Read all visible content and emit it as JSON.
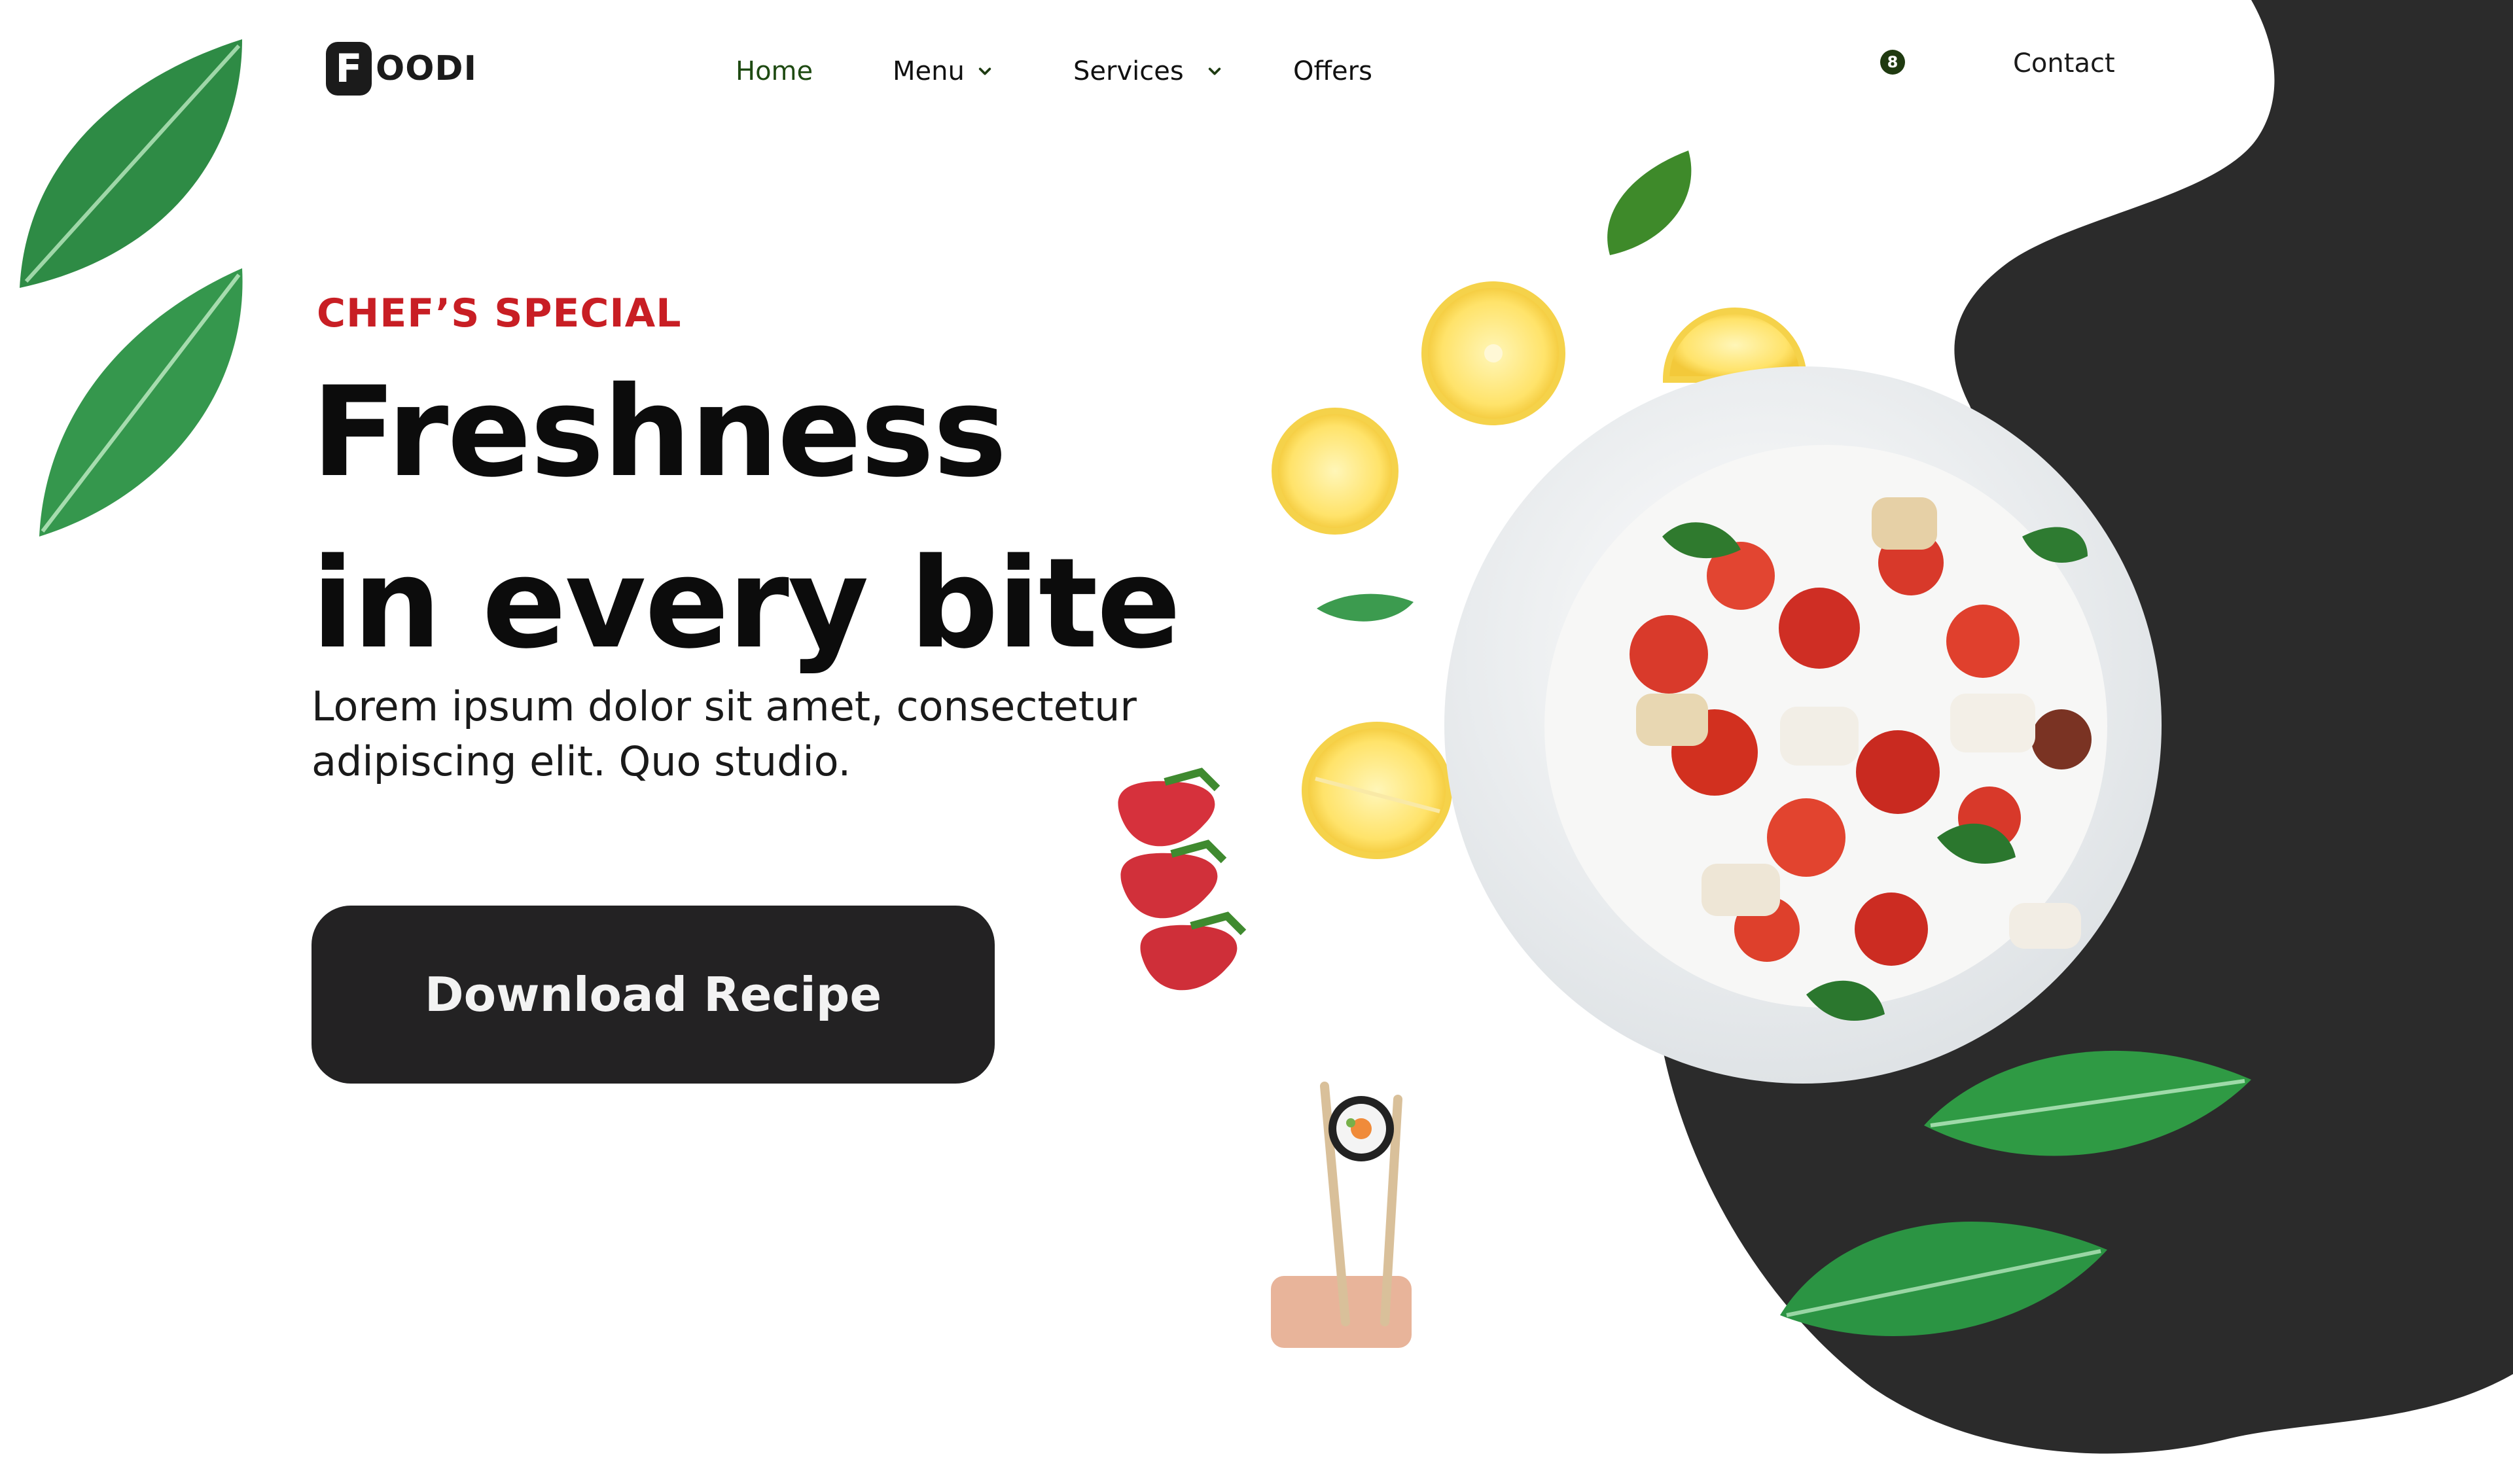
{
  "header": {
    "logo_letter": "F",
    "logo_text": "OODI",
    "nav": [
      {
        "label": "Home",
        "active": true,
        "dropdown": false
      },
      {
        "label": "Menu",
        "active": false,
        "dropdown": true
      },
      {
        "label": "Services",
        "active": false,
        "dropdown": true
      },
      {
        "label": "Offers",
        "active": false,
        "dropdown": false
      }
    ],
    "cart_badge_count": "8",
    "contact_label": "Contact"
  },
  "hero": {
    "eyebrow": "CHEF’S SPECIAL",
    "headline_line1": "Freshness",
    "headline_line2": "in every bite",
    "description": "Lorem ipsum dolor sit amet, consectetur adipiscing elit. Quo studio.",
    "cta_label": "Download Recipe"
  },
  "icons": {
    "chevrons": "chevron-down-icon",
    "leaves": "leaf-icon",
    "lemons": "lemon-slice-icon",
    "strawberries": "strawberry-icon",
    "sushi": "sushi-chopsticks-icon",
    "plate": "salad-plate-image"
  },
  "colors": {
    "accent_red": "#c81e24",
    "active_nav_green": "#1e4a12",
    "dark_blob": "#2b2b2b",
    "button_bg": "#232223",
    "leaf_green": "#2f8f47"
  }
}
